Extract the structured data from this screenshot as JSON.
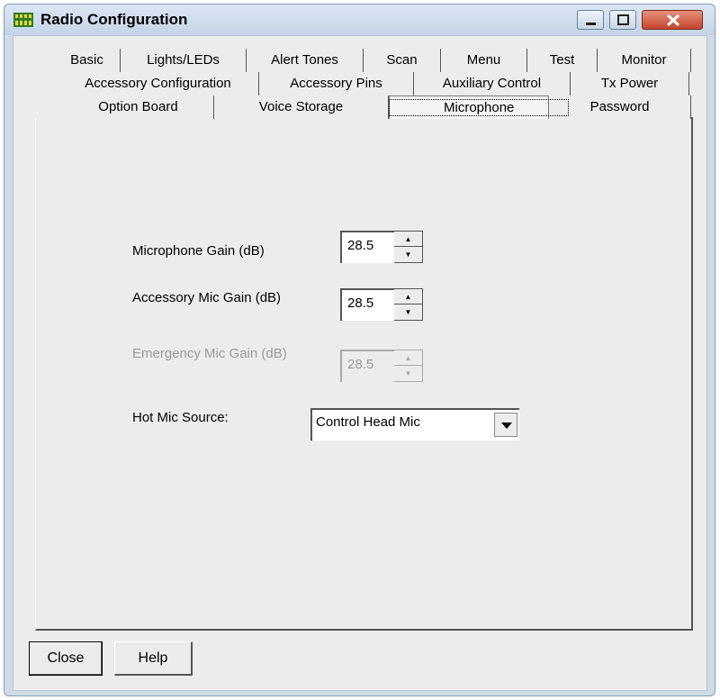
{
  "window": {
    "title": "Radio Configuration",
    "icon": "radio-app-icon",
    "accent_color": "#3a8f2e"
  },
  "tabs": {
    "row1": [
      "Basic",
      "Lights/LEDs",
      "Alert Tones",
      "Scan",
      "Menu",
      "Test",
      "Monitor"
    ],
    "row2": [
      "Accessory Configuration",
      "Accessory Pins",
      "Auxiliary Control",
      "Tx Power"
    ],
    "row3": [
      "Option Board",
      "Voice Storage",
      "Microphone",
      "Password"
    ],
    "active": "Microphone"
  },
  "form": {
    "mic_gain": {
      "label": "Microphone Gain (dB)",
      "value": "28.5"
    },
    "acc_mic_gain": {
      "label": "Accessory Mic Gain (dB)",
      "value": "28.5"
    },
    "emergency_mic_gain": {
      "label": "Emergency Mic Gain (dB)",
      "value": "28.5",
      "disabled": true
    },
    "hot_mic_source": {
      "label": "Hot Mic Source:",
      "value": "Control Head Mic"
    }
  },
  "buttons": {
    "close": "Close",
    "help": "Help"
  }
}
